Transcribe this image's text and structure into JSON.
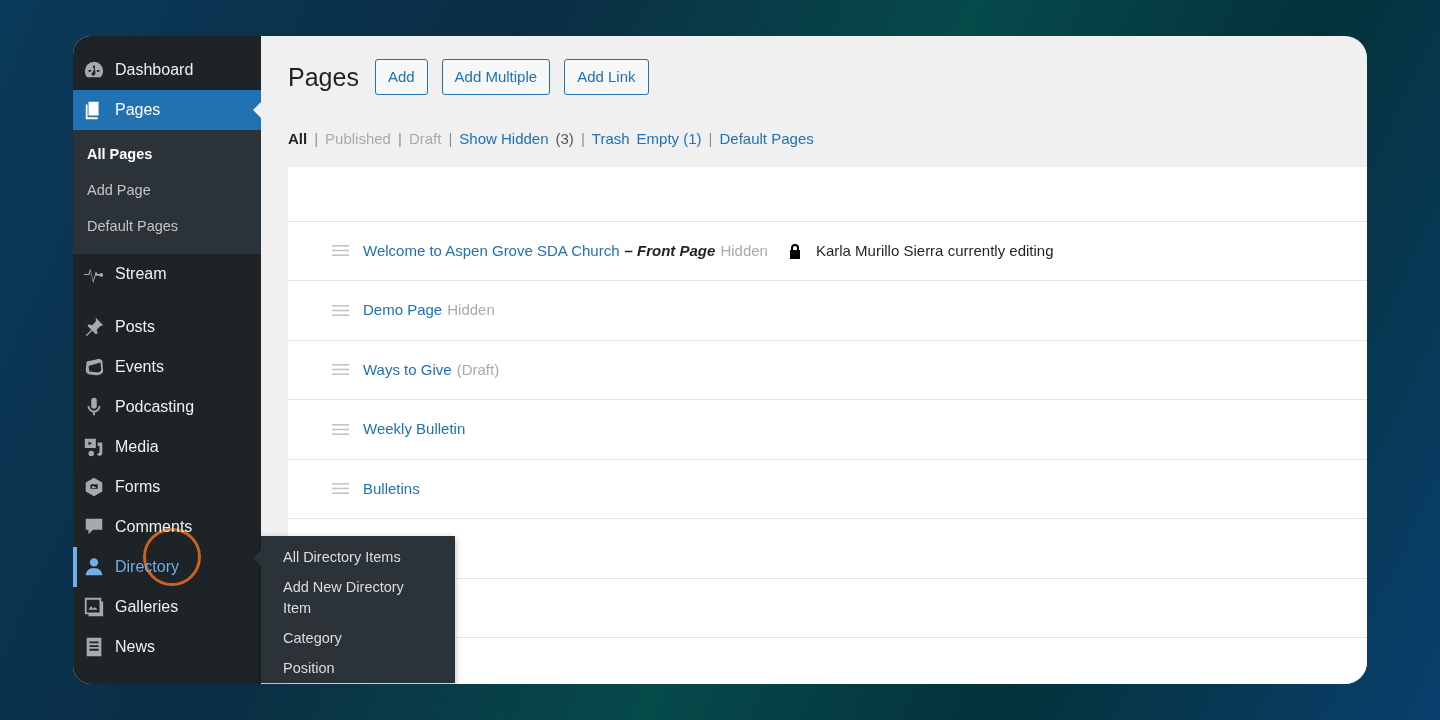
{
  "sidebar": {
    "items": [
      {
        "label": "Dashboard",
        "selected": false,
        "highlighted": false
      },
      {
        "label": "Pages",
        "selected": true,
        "highlighted": false,
        "children": [
          {
            "label": "All Pages",
            "selected": true
          },
          {
            "label": "Add Page",
            "selected": false
          },
          {
            "label": "Default Pages",
            "selected": false
          }
        ]
      },
      {
        "label": "Stream",
        "selected": false,
        "highlighted": false
      },
      {
        "label": "Posts",
        "selected": false,
        "highlighted": false
      },
      {
        "label": "Events",
        "selected": false,
        "highlighted": false
      },
      {
        "label": "Podcasting",
        "selected": false,
        "highlighted": false
      },
      {
        "label": "Media",
        "selected": false,
        "highlighted": false
      },
      {
        "label": "Forms",
        "selected": false,
        "highlighted": false
      },
      {
        "label": "Comments",
        "selected": false,
        "highlighted": false
      },
      {
        "label": "Directory",
        "selected": false,
        "highlighted": true,
        "flyout": [
          "All Directory Items",
          "Add New Directory Item",
          "Category",
          "Position"
        ]
      },
      {
        "label": "Galleries",
        "selected": false,
        "highlighted": false
      },
      {
        "label": "News",
        "selected": false,
        "highlighted": false
      }
    ]
  },
  "header": {
    "title": "Pages",
    "buttons": [
      "Add",
      "Add Multiple",
      "Add Link"
    ]
  },
  "filters": [
    {
      "kind": "current",
      "label": "All"
    },
    {
      "kind": "separator",
      "label": "|"
    },
    {
      "kind": "muted",
      "label": "Published"
    },
    {
      "kind": "separator",
      "label": "|"
    },
    {
      "kind": "muted",
      "label": "Draft"
    },
    {
      "kind": "separator",
      "label": "|"
    },
    {
      "kind": "link",
      "label": "Show Hidden"
    },
    {
      "kind": "count",
      "label": "(3)"
    },
    {
      "kind": "separator",
      "label": "|"
    },
    {
      "kind": "link",
      "label": "Trash"
    },
    {
      "kind": "link",
      "label": "Empty (1)"
    },
    {
      "kind": "separator",
      "label": "|"
    },
    {
      "kind": "link",
      "label": "Default Pages"
    }
  ],
  "rows": [
    {
      "title": "Welcome to Aspen Grove SDA Church",
      "post_state": "– Front Page",
      "status": "Hidden",
      "locked": true,
      "lock_note": "Karla Murillo Sierra currently editing"
    },
    {
      "title": "Demo Page",
      "status": "Hidden",
      "locked": false
    },
    {
      "title": "Ways to Give",
      "status": "(Draft)",
      "locked": false
    },
    {
      "title": "Weekly Bulletin",
      "locked": false
    },
    {
      "title": "Bulletins",
      "locked": false
    }
  ]
}
